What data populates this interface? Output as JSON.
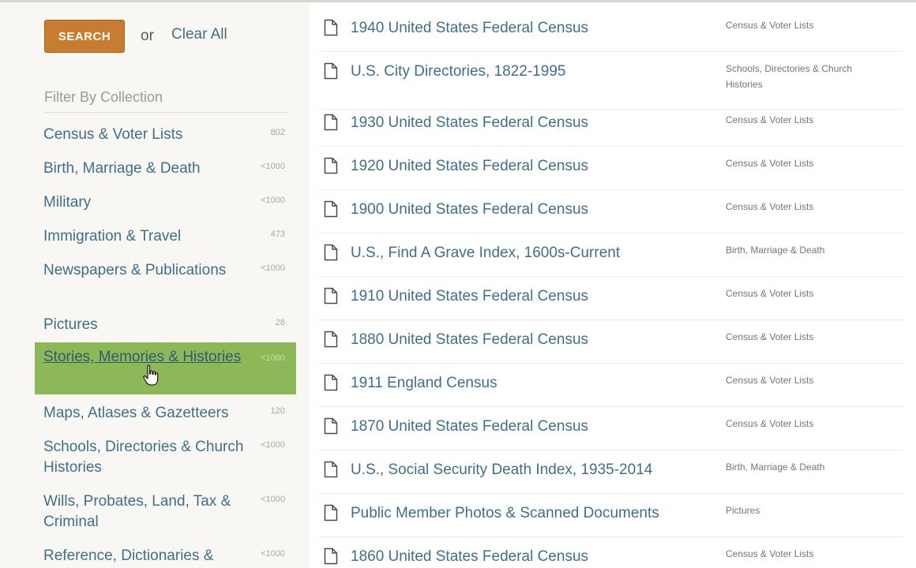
{
  "search": {
    "button_label": "SEARCH",
    "or_text": "or",
    "clear_all_label": "Clear All"
  },
  "filter": {
    "heading": "Filter By Collection",
    "items": [
      {
        "label": "Census & Voter Lists",
        "count": "802"
      },
      {
        "label": "Birth, Marriage & Death",
        "count": "<1000"
      },
      {
        "label": "Military",
        "count": "<1000"
      },
      {
        "label": "Immigration & Travel",
        "count": "473"
      },
      {
        "label": "Newspapers & Publications",
        "count": "<1000"
      },
      {
        "label": "Pictures",
        "count": "28"
      },
      {
        "label": "Stories, Memories & Histories",
        "count": "<1000",
        "selected": true
      },
      {
        "label": "Maps, Atlases & Gazetteers",
        "count": "120"
      },
      {
        "label": "Schools, Directories & Church Histories",
        "count": "<1000"
      },
      {
        "label": "Wills, Probates, Land, Tax & Criminal",
        "count": "<1000"
      },
      {
        "label": "Reference, Dictionaries &",
        "count": "<1000"
      }
    ]
  },
  "results": [
    {
      "title": "1940 United States Federal Census",
      "category": "Census & Voter Lists"
    },
    {
      "title": "U.S. City Directories, 1822-1995",
      "category": "Schools, Directories & Church Histories"
    },
    {
      "title": "1930 United States Federal Census",
      "category": "Census & Voter Lists"
    },
    {
      "title": "1920 United States Federal Census",
      "category": "Census & Voter Lists"
    },
    {
      "title": "1900 United States Federal Census",
      "category": "Census & Voter Lists"
    },
    {
      "title": "U.S., Find A Grave Index, 1600s-Current",
      "category": "Birth, Marriage & Death"
    },
    {
      "title": "1910 United States Federal Census",
      "category": "Census & Voter Lists"
    },
    {
      "title": "1880 United States Federal Census",
      "category": "Census & Voter Lists"
    },
    {
      "title": "1911 England Census",
      "category": "Census & Voter Lists"
    },
    {
      "title": "1870 United States Federal Census",
      "category": "Census & Voter Lists"
    },
    {
      "title": "U.S., Social Security Death Index, 1935-2014",
      "category": "Birth, Marriage & Death"
    },
    {
      "title": "Public Member Photos & Scanned Documents",
      "category": "Pictures"
    },
    {
      "title": "1860 United States Federal Census",
      "category": "Census & Voter Lists"
    }
  ],
  "colors": {
    "accent_button": "#c87c30",
    "selected_filter": "#8db857",
    "link": "#3f6f8a"
  },
  "icons": {
    "result_icon": "document-icon",
    "pointer": "hand-cursor-icon"
  }
}
